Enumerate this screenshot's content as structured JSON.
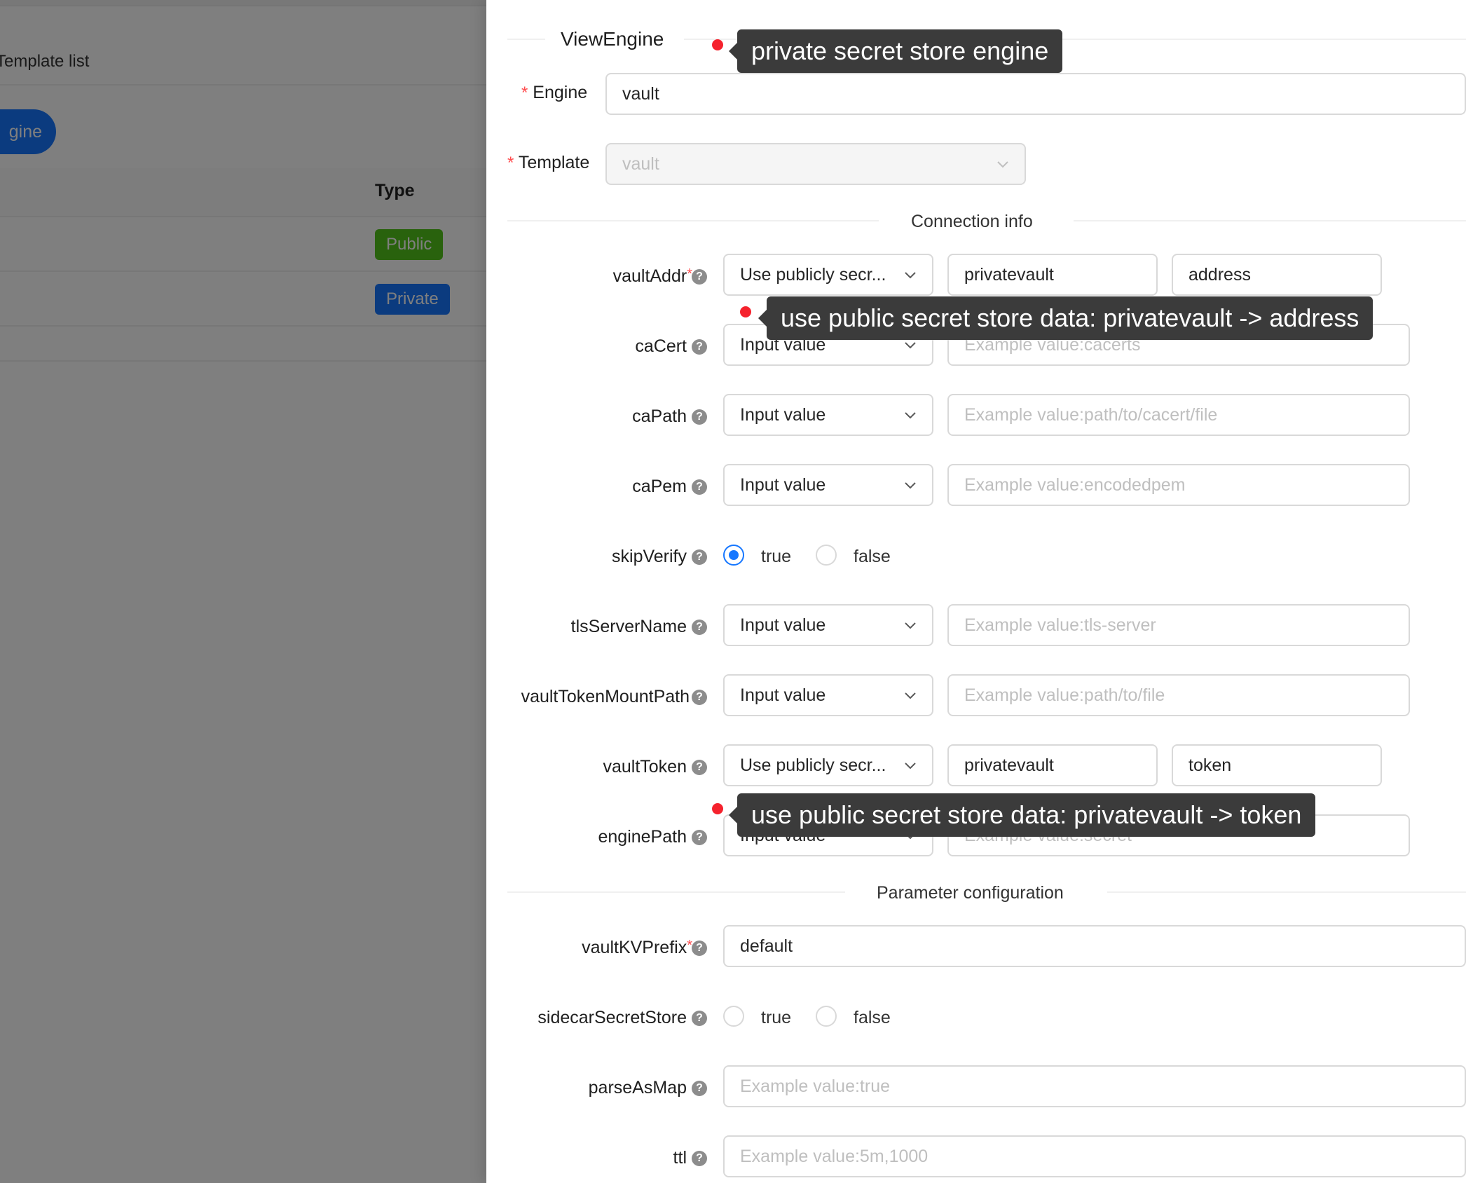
{
  "background": {
    "breadcrumb": "Template list",
    "button_label": "gine",
    "table": {
      "type_header": "Type",
      "rows": [
        {
          "type": "Public",
          "color": "#52c41a"
        },
        {
          "type": "Private",
          "color": "#1677ff"
        }
      ]
    }
  },
  "drawer": {
    "title": "ViewEngine",
    "engine": {
      "label": "Engine",
      "value": "vault"
    },
    "template": {
      "label": "Template",
      "value": "vault"
    },
    "sections": {
      "connection": "Connection info",
      "parameters": "Parameter configuration"
    },
    "fields": {
      "vaultAddr": {
        "label": "vaultAddr",
        "mode": "Use publicly secr...",
        "store": "privatevault",
        "key": "address"
      },
      "caCert": {
        "label": "caCert",
        "mode": "Input value",
        "placeholder": "Example value:cacerts"
      },
      "caPath": {
        "label": "caPath",
        "mode": "Input value",
        "placeholder": "Example value:path/to/cacert/file"
      },
      "caPem": {
        "label": "caPem",
        "mode": "Input value",
        "placeholder": "Example value:encodedpem"
      },
      "skipVerify": {
        "label": "skipVerify",
        "options": [
          "true",
          "false"
        ],
        "selected": "true"
      },
      "tlsServerName": {
        "label": "tlsServerName",
        "mode": "Input value",
        "placeholder": "Example value:tls-server"
      },
      "vaultTokenMountPath": {
        "label": "vaultTokenMountPath",
        "mode": "Input value",
        "placeholder": "Example value:path/to/file"
      },
      "vaultToken": {
        "label": "vaultToken",
        "mode": "Use publicly secr...",
        "store": "privatevault",
        "key": "token"
      },
      "enginePath": {
        "label": "enginePath",
        "mode": "Input value",
        "placeholder": "Example value:secret"
      },
      "vaultKVPrefix": {
        "label": "vaultKVPrefix",
        "value": "default"
      },
      "sidecarSecretStore": {
        "label": "sidecarSecretStore",
        "options": [
          "true",
          "false"
        ],
        "selected": ""
      },
      "parseAsMap": {
        "label": "parseAsMap",
        "placeholder": "Example value:true"
      },
      "ttl": {
        "label": "ttl",
        "placeholder": "Example value:5m,1000"
      }
    }
  },
  "annotations": {
    "engine_note": "private secret store engine",
    "address_note": "use public secret store data: privatevault -> address",
    "token_note": "use public secret store data: privatevault -> token"
  },
  "colors": {
    "primary": "#1677ff",
    "required": "#ff4d4f",
    "annotation_dot": "#f5222d",
    "tooltip_bg": "#3b3b3b"
  }
}
